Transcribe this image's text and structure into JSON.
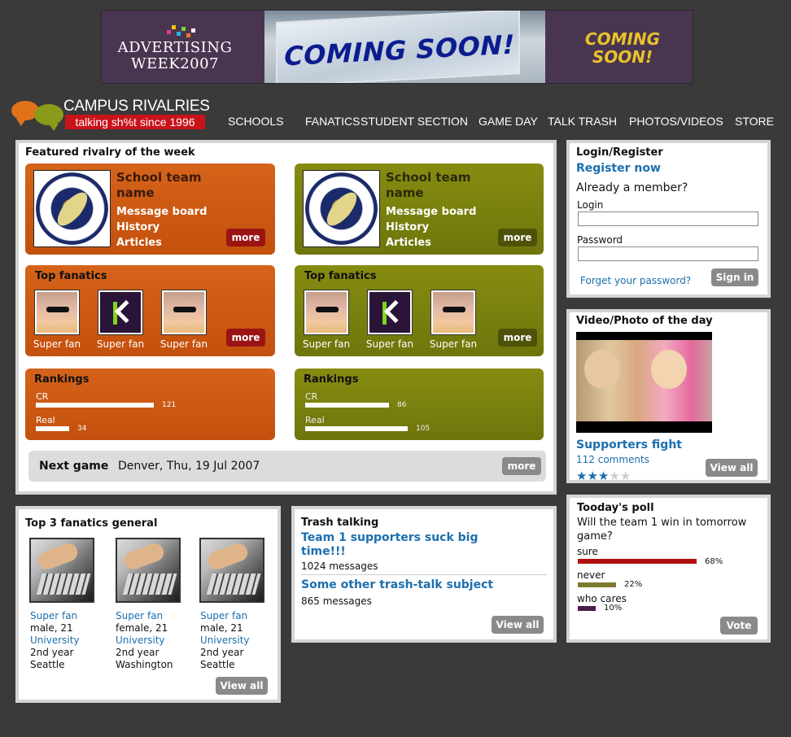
{
  "banner": {
    "adweek": "ADVERTISING WEEK2007",
    "coming_soon": "COMING SOON!",
    "coming_soon_side": "COMING SOON!"
  },
  "brand": {
    "name": "CAMPUS RIVALRIES",
    "tagline": "talking sh%t since 1996"
  },
  "nav": [
    "SCHOOLS",
    "FANATICS",
    "STUDENT SECTION",
    "GAME DAY",
    "TALK TRASH",
    "PHOTOS/VIDEOS",
    "STORE"
  ],
  "featured": {
    "title": "Featured rivalry of the week",
    "teams": [
      {
        "name": "School team name",
        "links": [
          "Message board",
          "History",
          "Articles"
        ],
        "more": "more",
        "fanatics_title": "Top fanatics",
        "fans": [
          "Super fan",
          "Super fan",
          "Super fan"
        ],
        "rankings_title": "Rankings",
        "rankings": [
          {
            "label": "CR",
            "value": "121",
            "fraction": 0.121
          },
          {
            "label": "Real",
            "value": "34",
            "fraction": 0.034
          }
        ]
      },
      {
        "name": "School team name",
        "links": [
          "Message board",
          "History",
          "Articles"
        ],
        "more": "more",
        "fanatics_title": "Top fanatics",
        "fans": [
          "Super fan",
          "Super fan",
          "Super fan"
        ],
        "rankings_title": "Rankings",
        "rankings": [
          {
            "label": "CR",
            "value": "86",
            "fraction": 0.086
          },
          {
            "label": "Real",
            "value": "105",
            "fraction": 0.105
          }
        ]
      }
    ],
    "next_game_label": "Next game",
    "next_game_value": "Denver, Thu, 19 Jul 2007",
    "next_game_more": "more"
  },
  "login": {
    "title": "Login/Register",
    "register": "Register now",
    "already": "Already a member?",
    "login_label": "Login",
    "password_label": "Password",
    "forgot": "Forget your password?",
    "signin": "Sign in"
  },
  "video": {
    "title": "Video/Photo of the day",
    "caption": "Supporters fight",
    "comments": "112 comments",
    "rating": 3,
    "rating_max": 5,
    "view_all": "View all"
  },
  "top3": {
    "title": "Top 3 fanatics general",
    "fans": [
      {
        "role": "Super fan",
        "info": "male, 21",
        "school": "University",
        "year": "2nd year",
        "city": "Seattle"
      },
      {
        "role": "Super fan",
        "info": "female, 21",
        "school": "University",
        "year": "2nd year",
        "city": "Washington"
      },
      {
        "role": "Super fan",
        "info": "male, 21",
        "school": "University",
        "year": "2nd year",
        "city": "Seattle"
      }
    ],
    "view_all": "View all"
  },
  "trash": {
    "title": "Trash talking",
    "topics": [
      {
        "title": "Team 1 supporters suck big time!!!",
        "count": "1024 messages"
      },
      {
        "title": "Some other trash-talk subject",
        "count": "865 messages"
      }
    ],
    "view_all": "View all"
  },
  "poll": {
    "title": "Tooday's poll",
    "question": "Will the team 1 win in tomorrow game?",
    "options": [
      {
        "label": "sure",
        "pct": "68%",
        "fraction": 0.68,
        "color": "#b01010"
      },
      {
        "label": "never",
        "pct": "22%",
        "fraction": 0.22,
        "color": "#7f7b2e"
      },
      {
        "label": "who cares",
        "pct": "10%",
        "fraction": 0.1,
        "color": "#4a1d4a"
      }
    ],
    "vote": "Vote"
  },
  "colors": {
    "orange": "#c4500d",
    "olive": "#6e760c",
    "link": "#1b6fae",
    "background": "#3a3a3a"
  }
}
